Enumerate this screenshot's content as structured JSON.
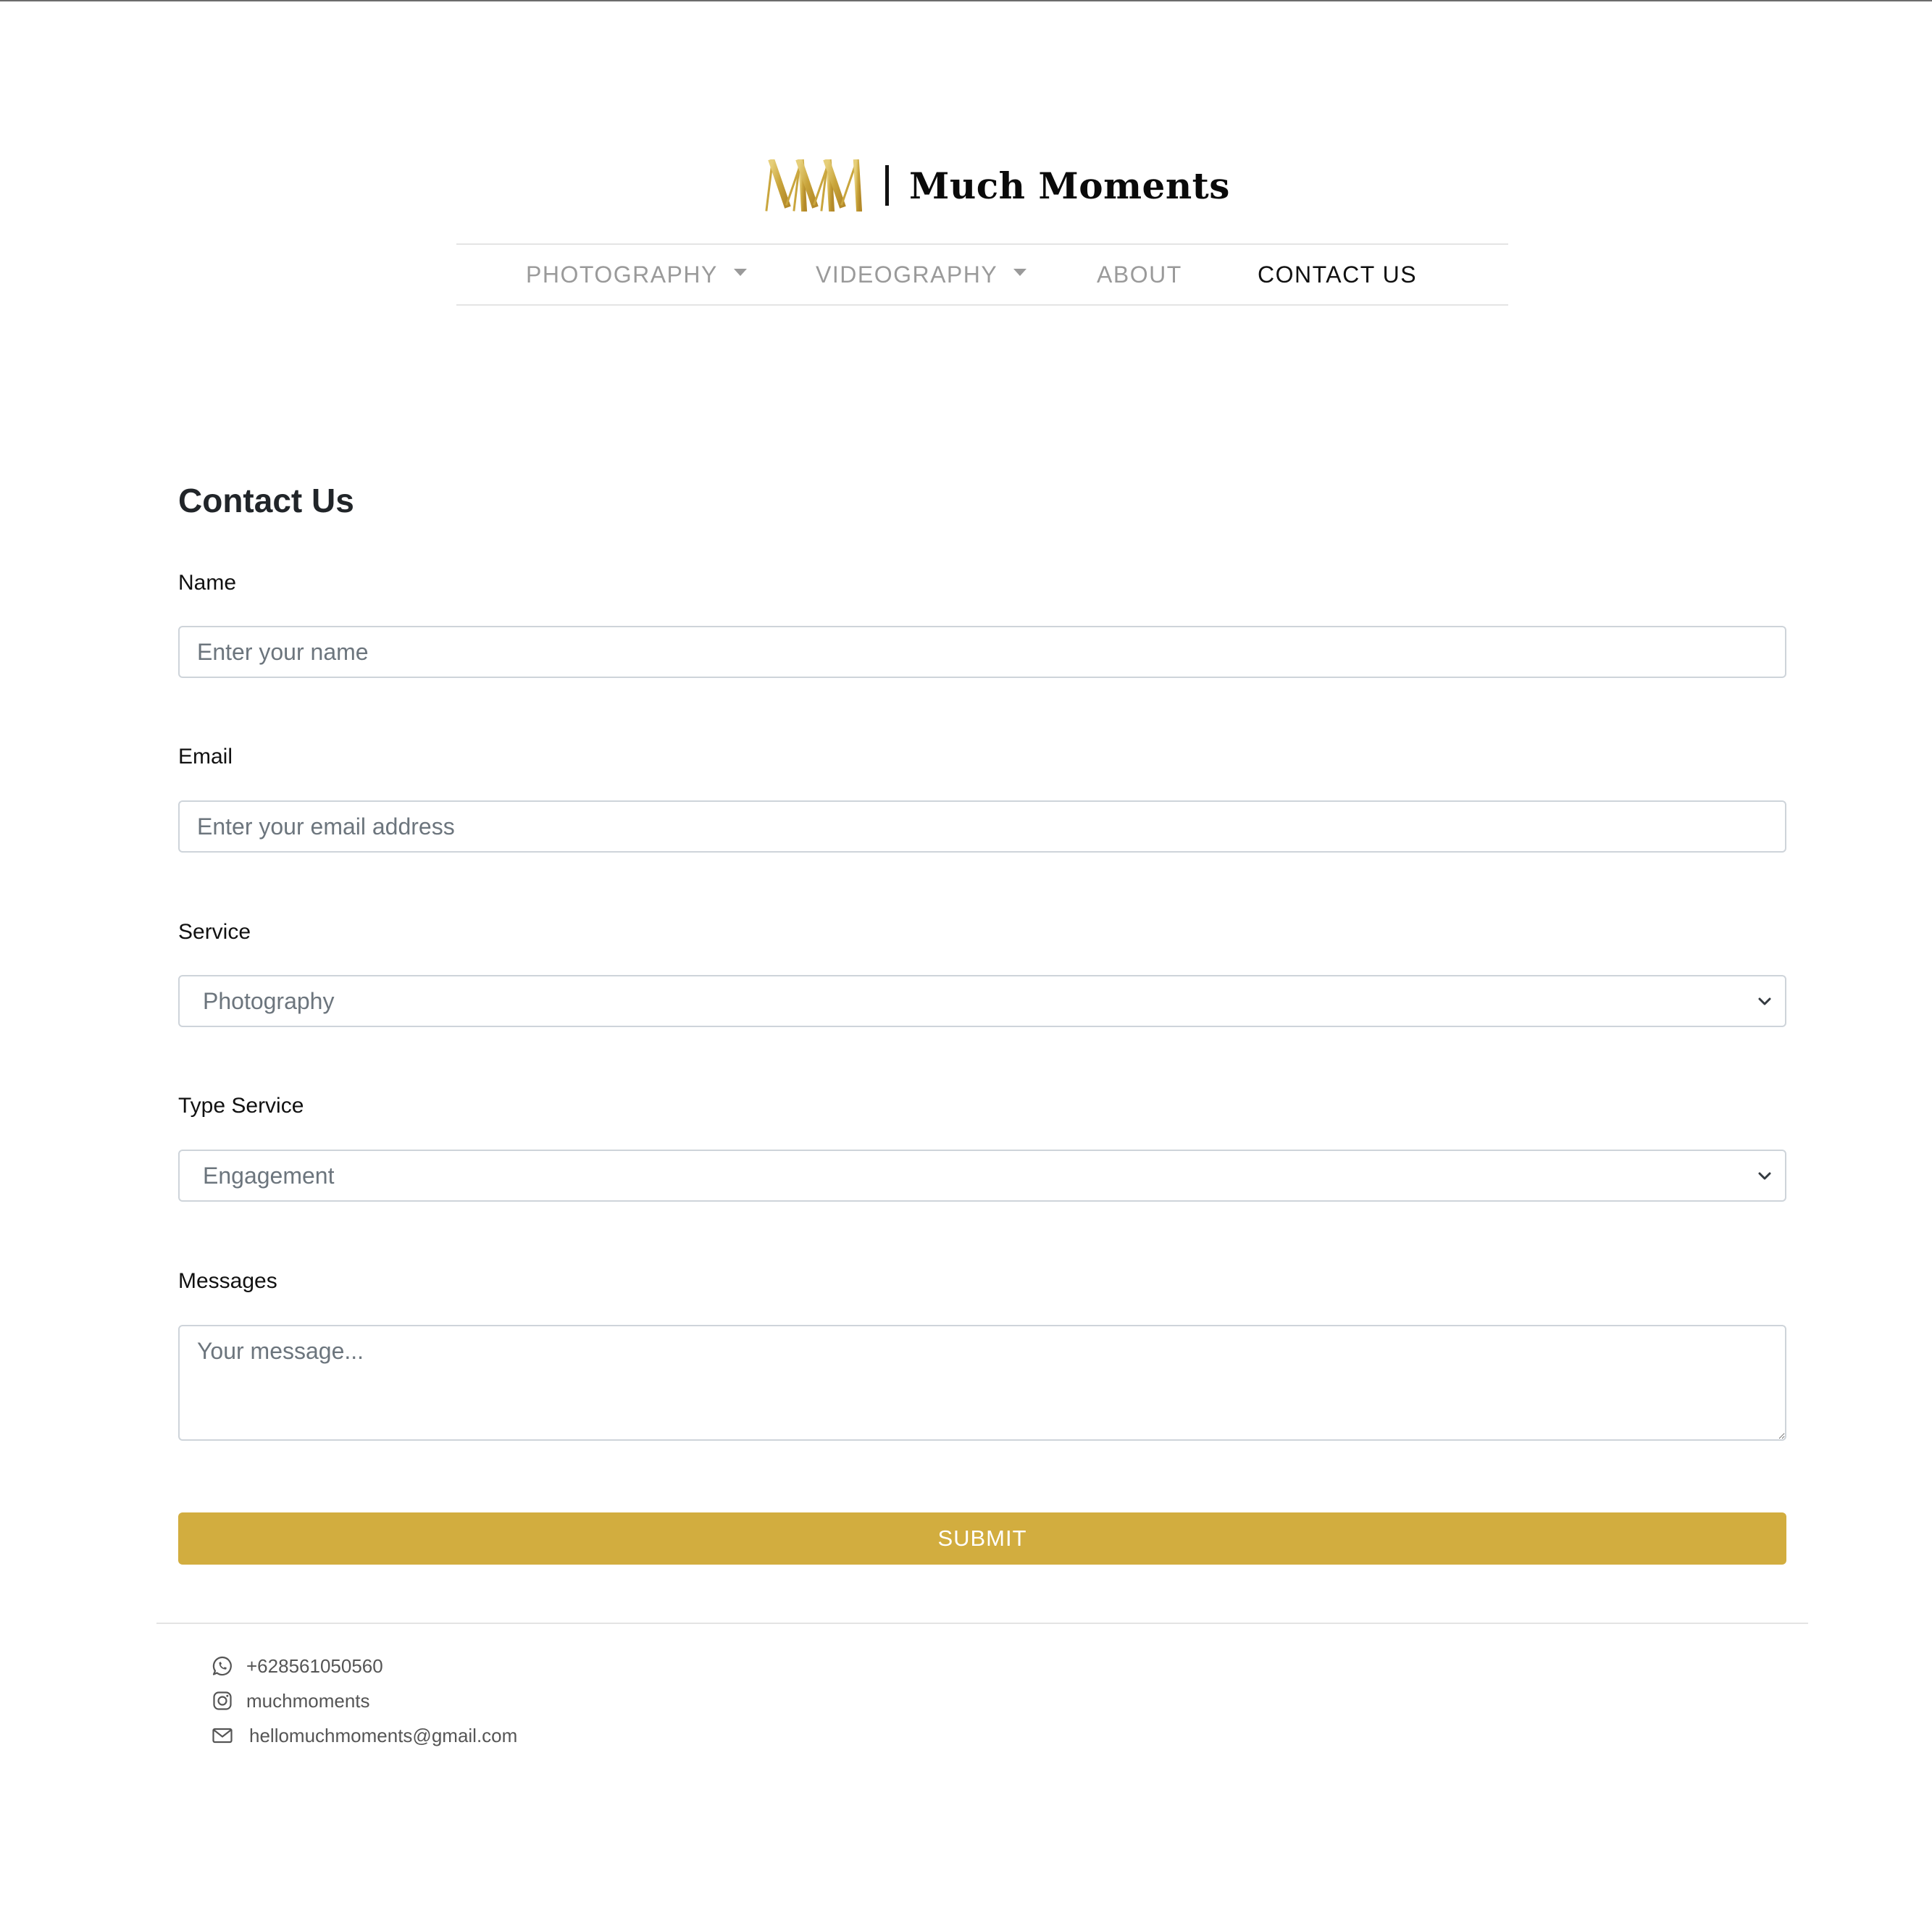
{
  "brand": {
    "name": "Much Moments",
    "logo_icon": "mm-monogram-logo",
    "logo_color": "#c9a53c"
  },
  "nav": {
    "items": [
      {
        "label": "PHOTOGRAPHY",
        "has_dropdown": true,
        "active": false
      },
      {
        "label": "VIDEOGRAPHY",
        "has_dropdown": true,
        "active": false
      },
      {
        "label": "ABOUT",
        "has_dropdown": false,
        "active": false
      },
      {
        "label": "CONTACT US",
        "has_dropdown": false,
        "active": true
      }
    ]
  },
  "form": {
    "title": "Contact Us",
    "name": {
      "label": "Name",
      "placeholder": "Enter your name",
      "value": ""
    },
    "email": {
      "label": "Email",
      "placeholder": "Enter your email address",
      "value": ""
    },
    "service": {
      "label": "Service",
      "selected": "Photography"
    },
    "type_service": {
      "label": "Type Service",
      "selected": "Engagement"
    },
    "messages": {
      "label": "Messages",
      "placeholder": "Your message...",
      "value": ""
    },
    "submit_label": "SUBMIT"
  },
  "footer": {
    "contacts": [
      {
        "icon": "whatsapp-icon",
        "text": "+628561050560"
      },
      {
        "icon": "instagram-icon",
        "text": "muchmoments"
      },
      {
        "icon": "envelope-icon",
        "text": "hellomuchmoments@gmail.com"
      }
    ]
  },
  "colors": {
    "accent": "#d2ad3f",
    "nav_inactive": "#9a9a9a",
    "nav_active": "#111111",
    "border": "#ced4da"
  }
}
